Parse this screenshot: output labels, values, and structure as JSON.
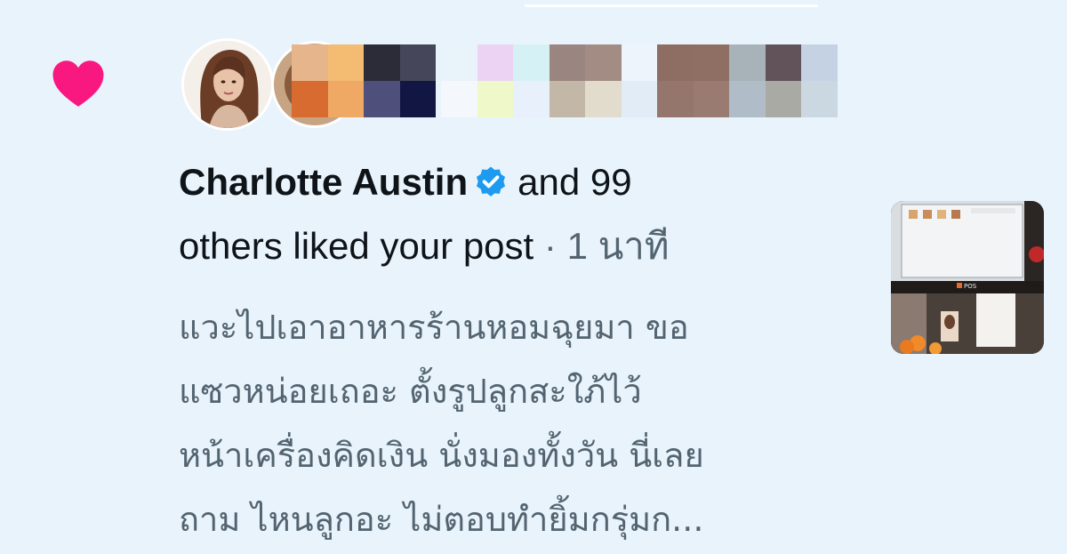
{
  "notification": {
    "icon": "heart-icon",
    "user_name": "Charlotte Austin",
    "verified": true,
    "count_text": "and 99",
    "action_text": "others liked your post",
    "separator": "·",
    "time": "1 นาที",
    "post_lines": [
      "แวะไปเอาอาหารร้านหอมฉุยมา ขอ",
      "แซวหน่อยเถอะ ตั้งรูปลูกสะใภ้ไว้",
      "หน้าเครื่องคิดเงิน นั่งมองทั้งวัน นี่เลย",
      "ถาม ไหนลูกอะ ไม่ตอบทำยิ้มกรุ่มก..."
    ],
    "thumbnail_label": "POS"
  },
  "colors": {
    "background": "#e8f3fb",
    "heart": "#f91880",
    "verified": "#1d9bf0",
    "primary_text": "#0f1419",
    "secondary_text": "#536471"
  }
}
